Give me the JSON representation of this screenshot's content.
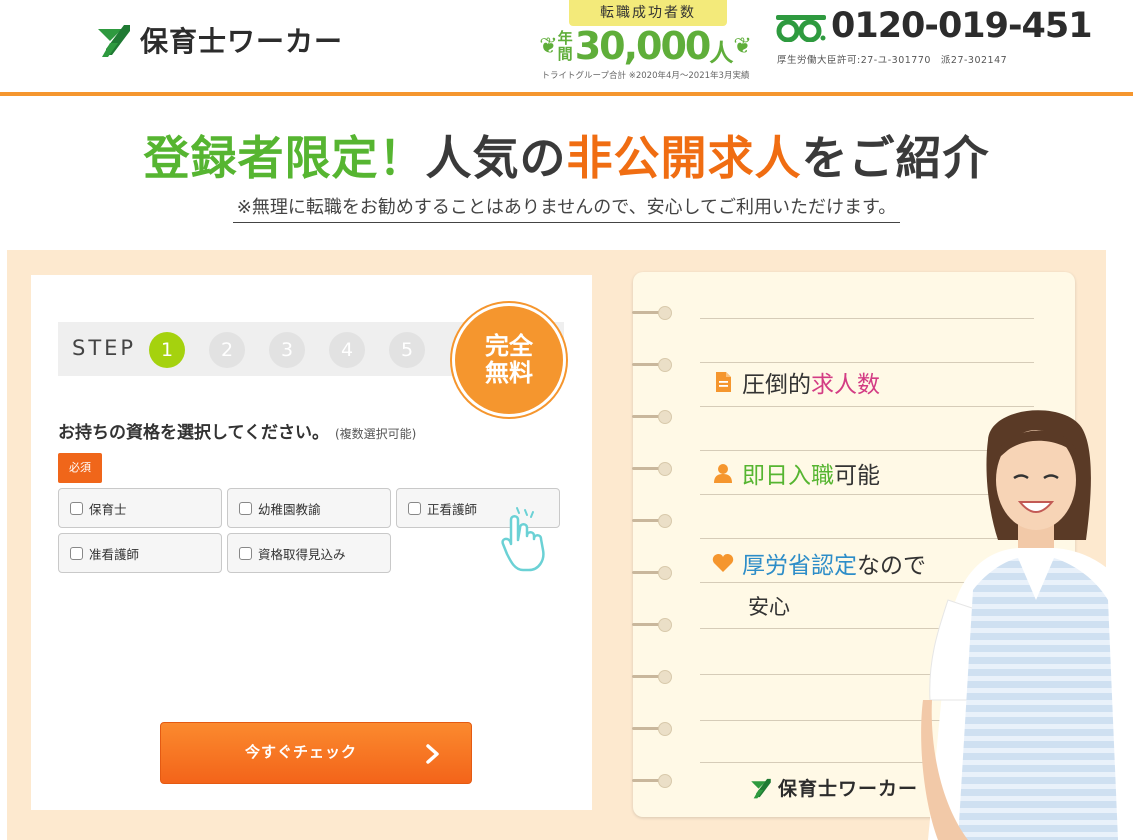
{
  "header": {
    "logo_text": "保育士ワーカー",
    "achievement": {
      "ribbon": "転職成功者数",
      "year_label": "年間",
      "number": "30,000",
      "unit": "人",
      "note": "トライトグループ合計 ※2020年4月～2021年3月実績"
    },
    "phone": {
      "icon": "freedial-icon",
      "number": "0120-019-451",
      "license": "厚生労働大臣許可:27-ユ-301770　派27-302147"
    }
  },
  "headline": {
    "part1": "登録者限定！",
    "part2": "人気の",
    "part3": "非公開求人",
    "part4": "をご紹介",
    "subline": "※無理に転職をお勧めすることはありませんので、安心してご利用いただけます。"
  },
  "form": {
    "step_label": "STEP",
    "steps": [
      "1",
      "2",
      "3",
      "4",
      "5"
    ],
    "active_step": 1,
    "free_badge": "完全無料",
    "question": "お持ちの資格を選択してください。",
    "question_sub": "(複数選択可能)",
    "required": "必須",
    "options": [
      "保育士",
      "幼稚園教諭",
      "正看護師",
      "准看護師",
      "資格取得見込み"
    ],
    "cta": "今すぐチェック"
  },
  "features": {
    "item1_a": "圧倒的",
    "item1_b": "求人数",
    "item2_a": "即日入職",
    "item2_b": "可能",
    "item3_a": "厚労省認定",
    "item3_b": "なので",
    "item3_c": "安心",
    "logo_text": "保育士ワーカー"
  },
  "colors": {
    "accent_orange": "#f5962e",
    "cta_orange": "#f3641a",
    "green": "#56b531",
    "step_active": "#a5d20e",
    "panel_bg": "#fde9cf"
  }
}
